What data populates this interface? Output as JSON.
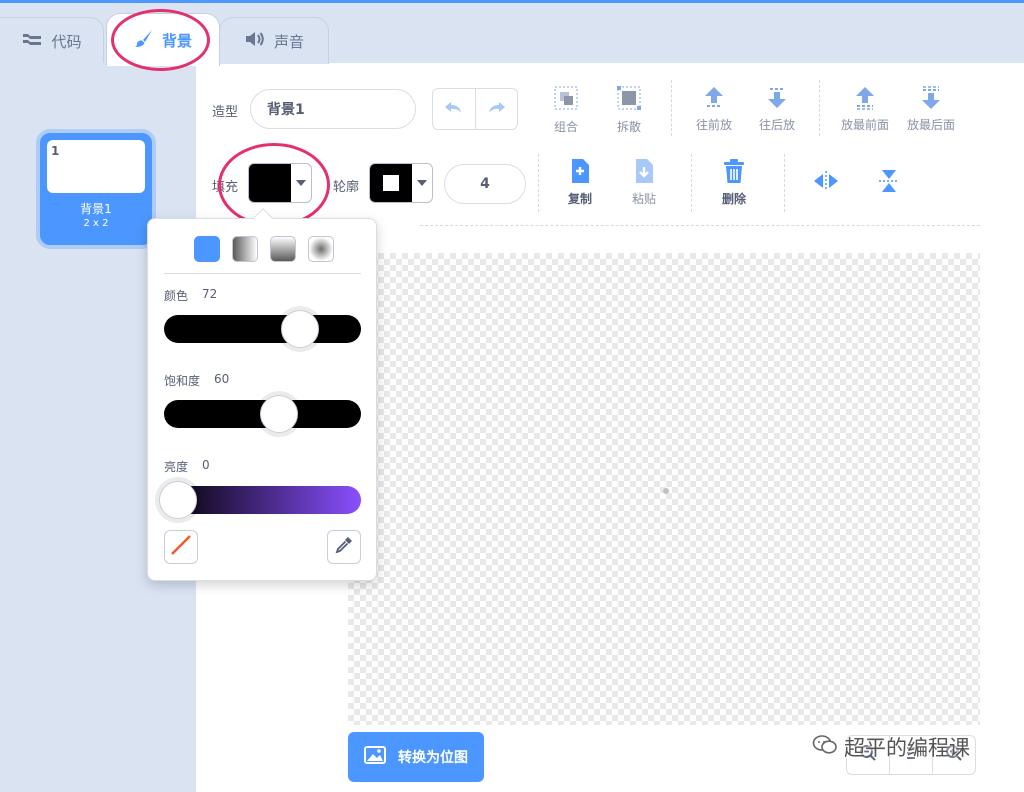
{
  "tabs": [
    {
      "label": "代码",
      "icon": "code-icon",
      "active": false
    },
    {
      "label": "背景",
      "icon": "brush-icon",
      "active": true
    },
    {
      "label": "声音",
      "icon": "speaker-icon",
      "active": false
    }
  ],
  "costume_list": [
    {
      "number": "1",
      "name": "背景1",
      "size": "2 x 2",
      "selected": true
    }
  ],
  "editor": {
    "costume_label": "造型",
    "costume_name": "背景1",
    "tools_row1": [
      {
        "label": "组合",
        "icon": "group-icon"
      },
      {
        "label": "拆散",
        "icon": "ungroup-icon"
      },
      {
        "label": "往前放",
        "icon": "forward-icon"
      },
      {
        "label": "往后放",
        "icon": "backward-icon"
      },
      {
        "label": "放最前面",
        "icon": "front-icon"
      },
      {
        "label": "放最后面",
        "icon": "back-icon"
      }
    ],
    "fill_label": "填充",
    "fill_color": "#000000",
    "outline_label": "轮廓",
    "outline_color": "#000000",
    "stroke_width": "4",
    "tools_row2": [
      {
        "label": "复制",
        "icon": "copy-icon"
      },
      {
        "label": "粘贴",
        "icon": "paste-icon"
      },
      {
        "label": "删除",
        "icon": "delete-icon"
      }
    ],
    "convert_label": "转换为位图"
  },
  "color_picker": {
    "modes": [
      "solid",
      "horizontal-gradient",
      "vertical-gradient",
      "radial-gradient"
    ],
    "hue": {
      "label": "颜色",
      "value": "72",
      "fraction": 0.72
    },
    "saturation": {
      "label": "饱和度",
      "value": "60",
      "fraction": 0.6
    },
    "brightness": {
      "label": "亮度",
      "value": "0",
      "fraction": 0.0
    }
  },
  "watermark": "超平的编程课",
  "colors": {
    "accent": "#4c97ff",
    "highlight_ring": "#e5306e",
    "brightness_end": "#8a4fff"
  }
}
